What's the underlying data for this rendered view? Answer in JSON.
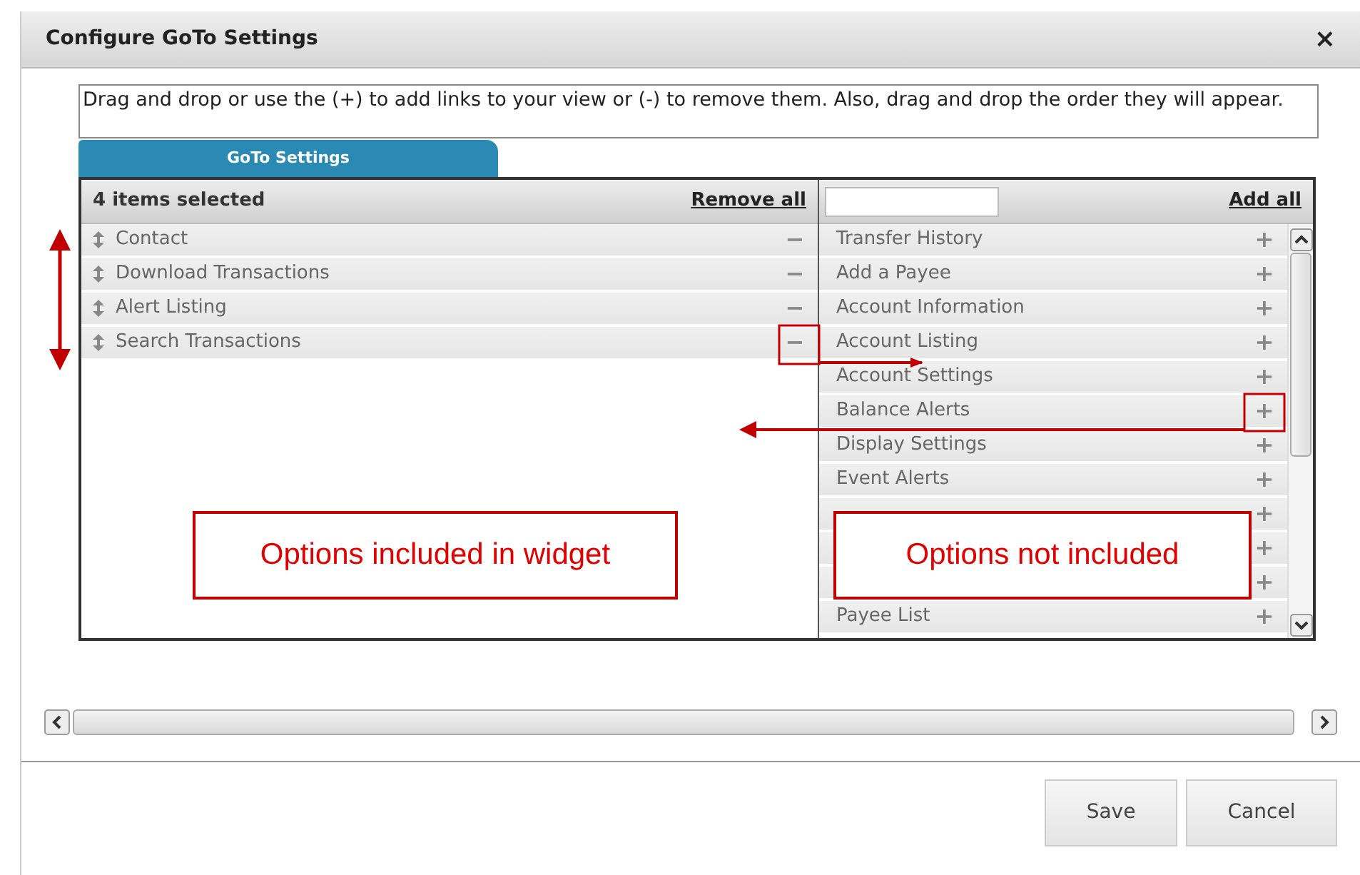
{
  "dialog": {
    "title": "Configure GoTo Settings",
    "close": "×"
  },
  "instructions": "Drag and drop or use the (+) to add links to your view or (-) to remove them. Also, drag and drop the order they will appear.",
  "tab": {
    "label": "GoTo Settings",
    "selected": true
  },
  "selected_panel": {
    "count": "4 items selected",
    "remove_all": "Remove all",
    "items": [
      {
        "label": "Contact",
        "action": "−"
      },
      {
        "label": "Download Transactions",
        "action": "−"
      },
      {
        "label": "Alert Listing",
        "action": "−"
      },
      {
        "label": "Search Transactions",
        "action": "−"
      }
    ]
  },
  "available_panel": {
    "add_all": "Add all",
    "items": [
      {
        "kind": "labeled",
        "label": "Transfer History",
        "action": "+"
      },
      {
        "kind": "labeled",
        "label": "Add a Payee",
        "action": "+"
      },
      {
        "kind": "labeled",
        "label": "Account Information",
        "action": "+"
      },
      {
        "kind": "labeled",
        "label": "Account Listing",
        "action": "+"
      },
      {
        "kind": "labeled",
        "label": "Account Settings",
        "action": "+"
      },
      {
        "kind": "labeled",
        "label": "Balance Alerts",
        "action": "+"
      },
      {
        "kind": "labeled",
        "label": "Display Settings",
        "action": "+"
      },
      {
        "kind": "labeled",
        "label": "Event Alerts",
        "action": "+"
      },
      {
        "kind": "covered",
        "action": "+"
      },
      {
        "kind": "covered",
        "action": "+"
      },
      {
        "kind": "covered",
        "action": "+"
      },
      {
        "kind": "labeled",
        "label": "Payee List",
        "action": "+"
      }
    ]
  },
  "callouts": [
    "Options included in widget",
    "Options not included"
  ],
  "buttons": [
    "Save",
    "Cancel"
  ]
}
